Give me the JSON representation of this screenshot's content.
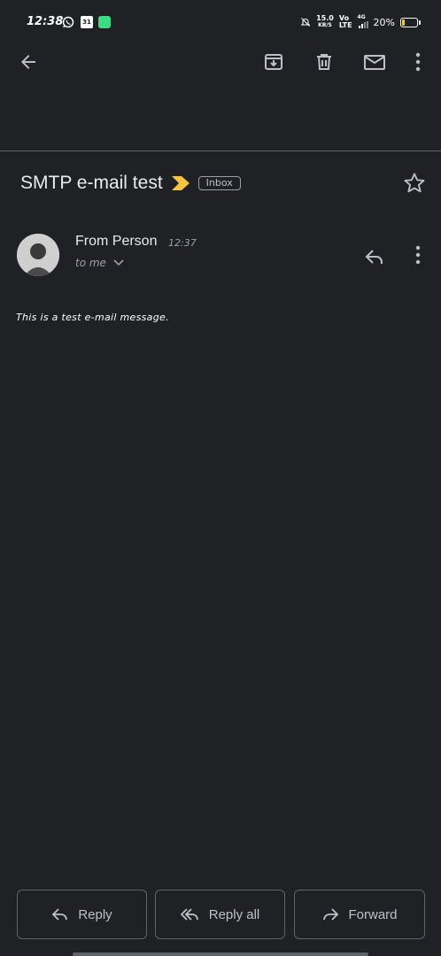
{
  "status_bar": {
    "time": "12:38",
    "speed_value": "15.0",
    "speed_unit": "KB/S",
    "net_top": "Vo",
    "net_bottom": "LTE",
    "net_gen": "4G",
    "battery_percent": "20%",
    "battery_level": 0.2,
    "battery_color": "#f6c343",
    "app_icons": [
      "whatsapp-icon",
      "calendar-icon",
      "green-app-icon"
    ],
    "calendar_day": "31"
  },
  "toolbar": {
    "icons": [
      "back-arrow-icon",
      "archive-icon",
      "delete-icon",
      "mark-unread-icon",
      "more-vert-icon"
    ]
  },
  "message": {
    "subject": "SMTP e-mail test",
    "label": "Inbox",
    "importance_color": "#f6c343",
    "sender_name": "From Person",
    "time": "12:37",
    "recipient": "to me",
    "body": "This is a test e-mail message."
  },
  "actions": {
    "reply": "Reply",
    "reply_all": "Reply all",
    "forward": "Forward"
  },
  "colors": {
    "background": "#202124",
    "text_primary": "#e8eaed",
    "text_secondary": "#9aa0a6",
    "border": "#5f6368"
  }
}
